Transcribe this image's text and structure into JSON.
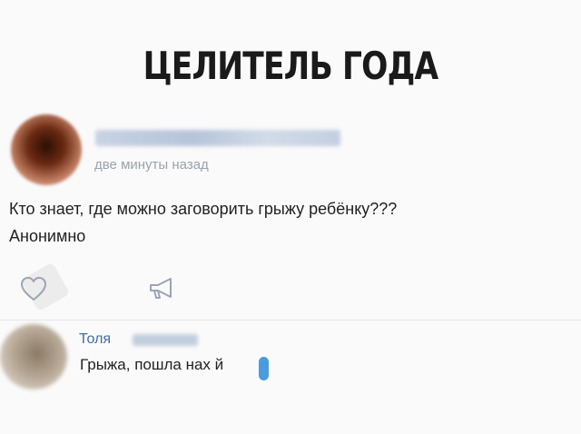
{
  "meme": {
    "title": "ЦЕЛИТЕЛЬ ГОДА"
  },
  "post": {
    "time": "две минуты назад",
    "text_line1": "Кто знает, где можно заговорить грыжу ребёнку???",
    "text_line2": "Анонимно"
  },
  "comment": {
    "author": "Толя",
    "text": "Грыжа, пошла нах  й"
  },
  "colors": {
    "link": "#3f6fa3",
    "censor": "#4a9be0",
    "muted": "#9aa3ad"
  },
  "icons": [
    "heart-outline-icon",
    "megaphone-share-icon"
  ]
}
